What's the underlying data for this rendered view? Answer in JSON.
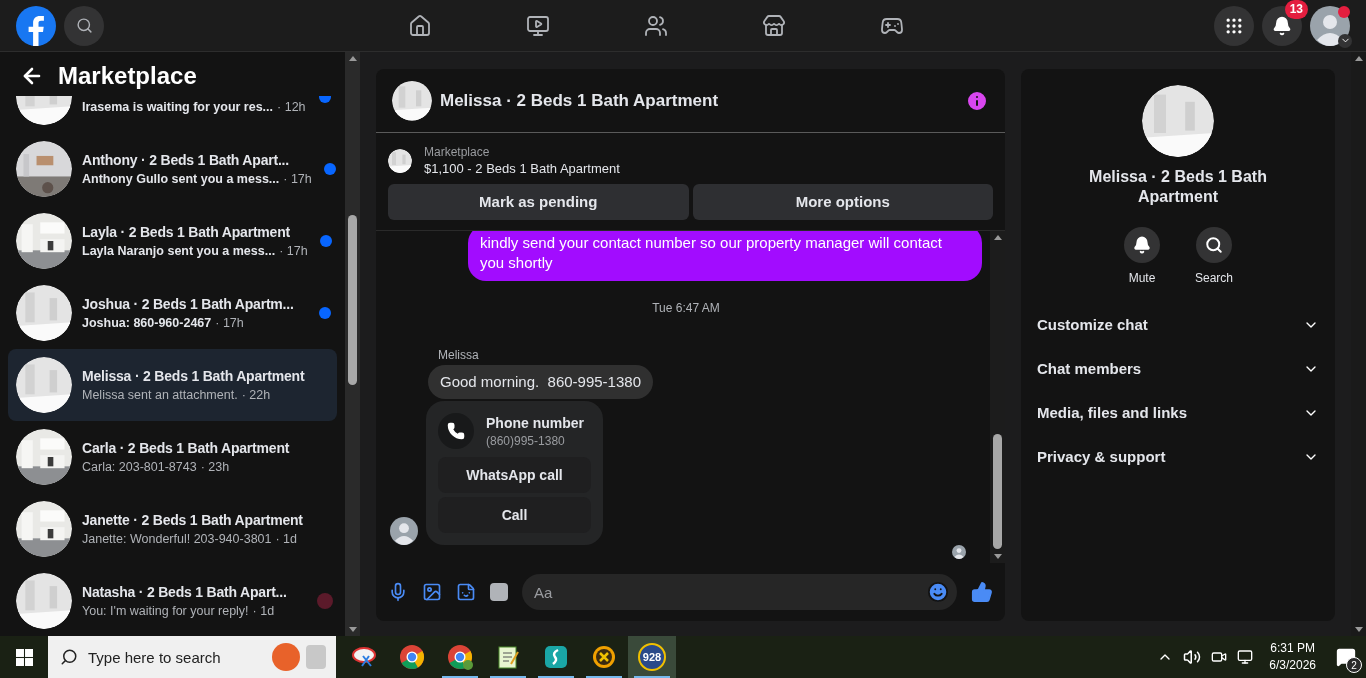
{
  "topbar": {
    "notification_count": "13"
  },
  "sidebar": {
    "title": "Marketplace",
    "conversations": [
      {
        "preview": "Irasema is waiting for your res...",
        "time": "· 12h",
        "unread": true,
        "selected": false,
        "seen": false
      },
      {
        "title": "Anthony · 2 Beds 1 Bath Apart...",
        "preview": "Anthony Gullo sent you a mess...",
        "time": "· 17h",
        "unread": true,
        "selected": false,
        "seen": false
      },
      {
        "title": "Layla · 2 Beds 1 Bath Apartment",
        "preview": "Layla Naranjo sent you a mess...",
        "time": "· 17h",
        "unread": true,
        "selected": false,
        "seen": false
      },
      {
        "title": "Joshua · 2 Beds 1 Bath Apartm...",
        "preview": "Joshua: 860-960-2467",
        "time": "· 17h",
        "unread": true,
        "selected": false,
        "seen": false
      },
      {
        "title": "Melissa · 2 Beds 1 Bath Apartment",
        "preview": "Melissa sent an attachment.",
        "time": "· 22h",
        "unread": false,
        "selected": true,
        "seen": false
      },
      {
        "title": "Carla · 2 Beds 1 Bath Apartment",
        "preview": "Carla: 203-801-8743",
        "time": "· 23h",
        "unread": false,
        "selected": false,
        "seen": false
      },
      {
        "title": "Janette · 2 Beds 1 Bath Apartment",
        "preview": "Janette: Wonderful! 203-940-3801",
        "time": "· 1d",
        "unread": false,
        "selected": false,
        "seen": false
      },
      {
        "title": "Natasha · 2 Beds 1 Bath Apart...",
        "preview": "You: I'm waiting for your reply!",
        "time": "· 1d",
        "unread": false,
        "selected": false,
        "seen": true
      }
    ]
  },
  "chat": {
    "title": "Melissa · 2 Beds 1 Bath Apartment",
    "listing": {
      "label": "Marketplace",
      "text": "$1,100 - 2 Beds 1 Bath Apartment"
    },
    "actions": [
      "Mark as pending",
      "More options"
    ],
    "messages": [
      {
        "kind": "outgoing",
        "text": "kindly send your contact number so our property manager will contact you shortly"
      },
      {
        "kind": "timestamp",
        "text": "Tue 6:47 AM"
      },
      {
        "kind": "sender",
        "text": "Melissa"
      },
      {
        "kind": "incoming",
        "text": "Good morning.  860-995-1380"
      },
      {
        "kind": "contact_card",
        "title": "Phone number",
        "value": "(860)995-1380",
        "buttons": [
          "WhatsApp call",
          "Call"
        ]
      }
    ],
    "composer": {
      "placeholder": "Aa"
    }
  },
  "details": {
    "title": "Melissa · 2 Beds 1 Bath Apartment",
    "actions": [
      "Mute",
      "Search"
    ],
    "sections": [
      {
        "label": "Customize chat",
        "expanded": false
      },
      {
        "label": "Chat members",
        "expanded": false
      },
      {
        "label": "Media, files and links",
        "expanded": false
      },
      {
        "label": "Privacy & support",
        "expanded": false
      }
    ]
  },
  "taskbar": {
    "search_placeholder": "Type here to search",
    "apps": [
      {
        "kind": "snip",
        "running": false,
        "selected": false
      },
      {
        "kind": "chrome",
        "running": false,
        "selected": false
      },
      {
        "kind": "chrome_profile",
        "running": true,
        "selected": false
      },
      {
        "kind": "notepad",
        "running": true,
        "selected": false
      },
      {
        "kind": "shark",
        "running": true,
        "selected": false
      },
      {
        "kind": "ix",
        "running": true,
        "selected": false
      },
      {
        "kind": "badge",
        "label": "928",
        "running": true,
        "selected": true
      }
    ],
    "time": "6:31 PM",
    "date": "6/3/2026",
    "notification_count": "2"
  }
}
